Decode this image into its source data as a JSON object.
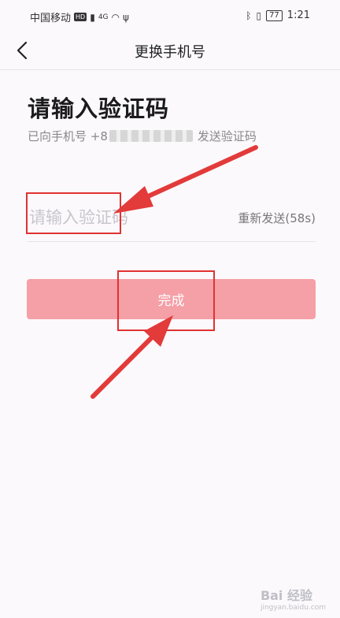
{
  "status_bar": {
    "carrier": "中国移动",
    "hd": "HD",
    "network": "4G",
    "battery": "77",
    "time": "1:21"
  },
  "nav": {
    "title": "更换手机号"
  },
  "verify": {
    "heading": "请输入验证码",
    "sent_prefix": "已向手机号 +8",
    "sent_suffix": "发送验证码",
    "code_placeholder": "请输入验证码",
    "resend": "重新发送(58s)"
  },
  "actions": {
    "done": "完成"
  },
  "watermark": {
    "brand": "Bai 经验",
    "url": "jingyan.baidu.com"
  },
  "colors": {
    "background": "#fbf9fc",
    "button": "#f59fa6",
    "annotation": "#e03232"
  }
}
